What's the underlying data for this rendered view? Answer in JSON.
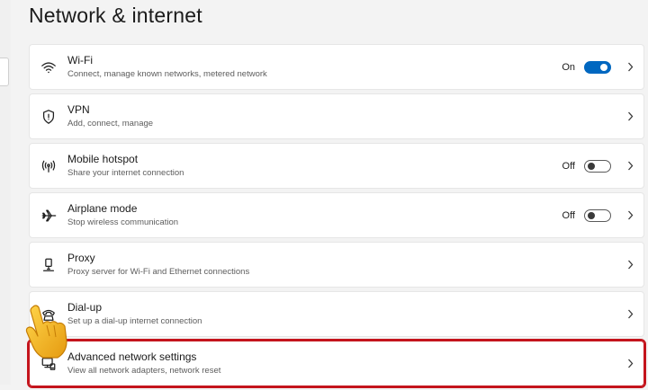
{
  "page": {
    "title": "Network & internet"
  },
  "rows": [
    {
      "id": "wifi",
      "title": "Wi-Fi",
      "desc": "Connect, manage known networks, metered network",
      "icon": "wifi-icon",
      "toggle": true,
      "toggle_state": "on",
      "toggle_label": "On"
    },
    {
      "id": "vpn",
      "title": "VPN",
      "desc": "Add, connect, manage",
      "icon": "shield-icon",
      "toggle": false
    },
    {
      "id": "hotspot",
      "title": "Mobile hotspot",
      "desc": "Share your internet connection",
      "icon": "hotspot-icon",
      "toggle": true,
      "toggle_state": "off",
      "toggle_label": "Off"
    },
    {
      "id": "airplane",
      "title": "Airplane mode",
      "desc": "Stop wireless communication",
      "icon": "airplane-icon",
      "toggle": true,
      "toggle_state": "off",
      "toggle_label": "Off"
    },
    {
      "id": "proxy",
      "title": "Proxy",
      "desc": "Proxy server for Wi-Fi and Ethernet connections",
      "icon": "proxy-icon",
      "toggle": false
    },
    {
      "id": "dialup",
      "title": "Dial-up",
      "desc": "Set up a dial-up internet connection",
      "icon": "dialup-icon",
      "toggle": false
    },
    {
      "id": "advanced",
      "title": "Advanced network settings",
      "desc": "View all network adapters, network reset",
      "icon": "monitor-network-icon",
      "toggle": false
    }
  ],
  "colors": {
    "accent": "#0067c0",
    "highlight": "#c4141c",
    "pointer": "#f2b21a"
  }
}
